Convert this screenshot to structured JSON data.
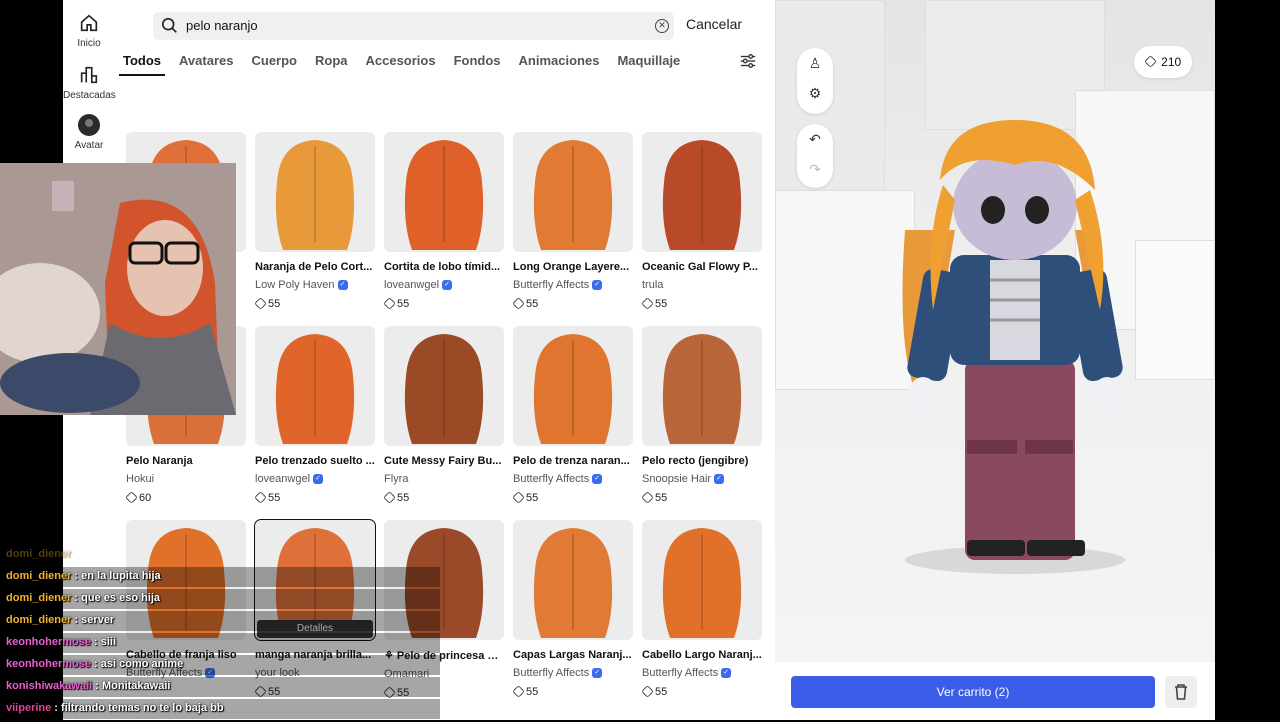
{
  "nav": {
    "home": "Inicio",
    "featured": "Destacadas",
    "avatar": "Avatar"
  },
  "search": {
    "value": "pelo naranjo",
    "cancel": "Cancelar"
  },
  "tabs": [
    "Todos",
    "Avatares",
    "Cuerpo",
    "Ropa",
    "Accesorios",
    "Fondos",
    "Animaciones",
    "Maquillaje"
  ],
  "items": [
    {
      "name": "",
      "creator": "",
      "price": "",
      "hair": "#e0703a"
    },
    {
      "name": "Naranja de Pelo Cort...",
      "creator": "Low Poly Haven",
      "verified": true,
      "price": "55",
      "hair": "#e89a3a"
    },
    {
      "name": "Cortita de lobo tímid...",
      "creator": "loveanwgel",
      "verified": true,
      "price": "55",
      "hair": "#e0602a"
    },
    {
      "name": "Long Orange Layere...",
      "creator": "Butterfly Affects",
      "verified": true,
      "price": "55",
      "hair": "#e07a35"
    },
    {
      "name": "Oceanic Gal Flowy P...",
      "creator": "trula",
      "verified": false,
      "price": "55",
      "hair": "#b84a2a"
    },
    {
      "name": "Pelo Naranja",
      "creator": "Hokui",
      "verified": false,
      "price": "60",
      "hair": "#d9703a"
    },
    {
      "name": "Pelo trenzado suelto ...",
      "creator": "loveanwgel",
      "verified": true,
      "price": "55",
      "hair": "#e0652a"
    },
    {
      "name": "Cute Messy Fairy Bu...",
      "creator": "Flyra",
      "verified": false,
      "price": "55",
      "hair": "#9a4a25"
    },
    {
      "name": "Pelo de trenza naran...",
      "creator": "Butterfly Affects",
      "verified": true,
      "price": "55",
      "hair": "#e07530"
    },
    {
      "name": "Pelo recto (jengibre)",
      "creator": "Snoopsie Hair",
      "verified": true,
      "price": "55",
      "hair": "#b8653a"
    },
    {
      "name": "Cabello de franja liso",
      "creator": "Butterfly Affects",
      "verified": true,
      "price": "",
      "hair": "#e0702a"
    },
    {
      "name": "manga naranja brilla...",
      "creator": "your look",
      "verified": false,
      "price": "55",
      "hair": "#e0703a",
      "selected": true,
      "details": "Detalles"
    },
    {
      "name": "⚘ Pelo de princesa m...",
      "creator": "Omamari",
      "verified": false,
      "price": "55",
      "hair": "#9a4a28"
    },
    {
      "name": "Capas Largas Naranj...",
      "creator": "Butterfly Affects",
      "verified": true,
      "price": "55",
      "hair": "#e07a35"
    },
    {
      "name": "Cabello Largo Naranj...",
      "creator": "Butterfly Affects",
      "verified": true,
      "price": "55",
      "hair": "#e0702a"
    }
  ],
  "preview": {
    "robux_balance": "210",
    "cart_button": "Ver carrito (2)"
  },
  "chat": [
    {
      "user": "domi_diener",
      "msg": "",
      "cls": "u-domi"
    },
    {
      "user": "domi_diener",
      "msg": "en la lupita hija",
      "cls": "u-domi"
    },
    {
      "user": "domi_diener",
      "msg": "que es eso hija",
      "cls": "u-domi"
    },
    {
      "user": "domi_diener",
      "msg": "server",
      "cls": "u-domi"
    },
    {
      "user": "keonhohermose",
      "msg": "siii",
      "cls": "u-keon"
    },
    {
      "user": "keonhohermose",
      "msg": "asi como anime",
      "cls": "u-keon"
    },
    {
      "user": "konishiwakawaii",
      "msg": "Monitakawaii",
      "cls": "u-koni"
    },
    {
      "user": "viiperine",
      "msg": "filtrando temas no te lo baja bb",
      "cls": "u-viip"
    }
  ],
  "colors": {
    "accent": "#3b5ce6",
    "verified": "#3b6cf0"
  }
}
